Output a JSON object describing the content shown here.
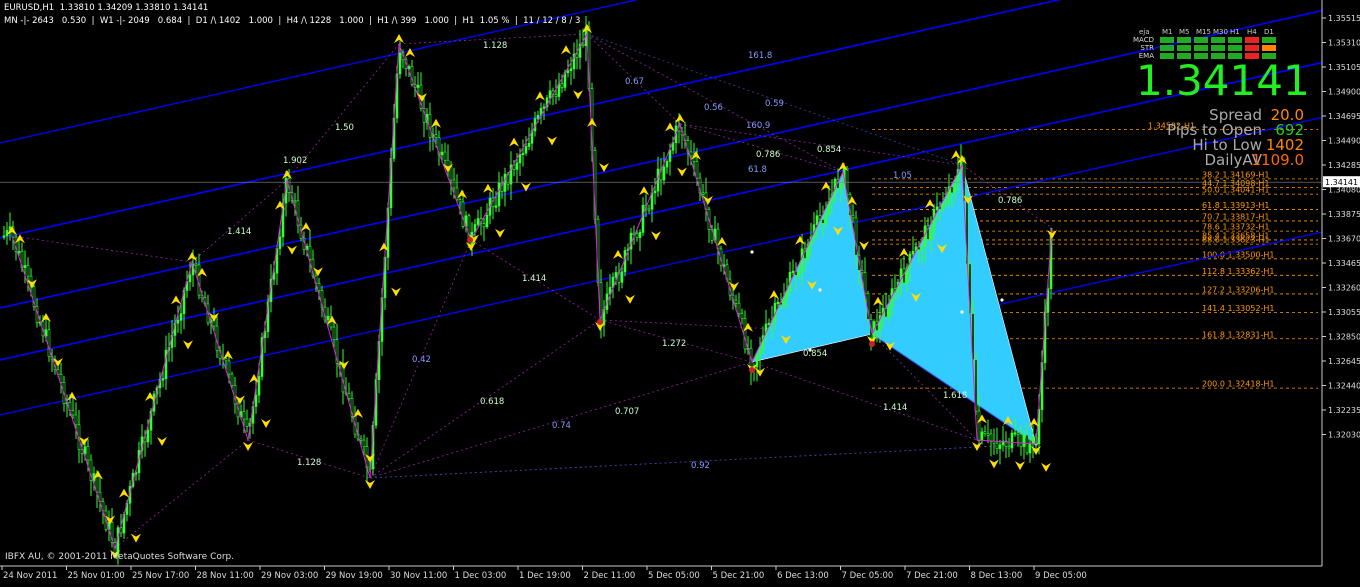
{
  "header": {
    "line1": "EURUSD,H1  1.33810 1.34209 1.33810 1.34141",
    "line2": "MN -|- 2643   0.530  |  W1 -|- 2049   0.684  |  D1 /\\ 1402   1.000  |  H4 /\\ 1228   1.000  |  H1 /\\ 399   1.000  |  H1  1.05 %  |  11 / 12 / 8 / 3"
  },
  "panel": {
    "label_tf": "eja",
    "timeframes": [
      "M1",
      "M5",
      "M15",
      "M30",
      "H1",
      "H4",
      "D1"
    ],
    "rows": [
      {
        "name": "MACD",
        "colors": [
          "#22aa22",
          "#22aa22",
          "#22aa22",
          "#22aa22",
          "#22aa22",
          "#ee2222",
          "#22aa22"
        ]
      },
      {
        "name": "STR",
        "colors": [
          "#22aa22",
          "#22aa22",
          "#22aa22",
          "#22aa22",
          "#22aa22",
          "#ee2222",
          "#ff8800"
        ]
      },
      {
        "name": "EMA",
        "colors": [
          "#22aa22",
          "#22aa22",
          "#22aa22",
          "#22aa22",
          "#22aa22",
          "#ee2222",
          "#22aa22"
        ]
      }
    ],
    "big_price": "1.34141",
    "stats": [
      {
        "label": "Spread",
        "value": "20.0",
        "color": "#ff8800"
      },
      {
        "label": "Pips to Open",
        "value": "692",
        "color": "#22cc22"
      },
      {
        "label": "Hi to Low",
        "value": "1402",
        "color": "#ff8800"
      },
      {
        "label": "DailyAV",
        "value": "1109.0",
        "color": "#ff6600"
      }
    ]
  },
  "copyright": "IBFX AU, © 2001-2011 MetaQuotes Software Corp.",
  "current_price_tag": "1.34141",
  "colors": {
    "candle": "#33ff33",
    "channel": "#0000ff",
    "pattern_fill": "#33ccff",
    "fib_level": "#ff9900",
    "zigzag": "#dd22dd",
    "arrow": "#ffdd00"
  },
  "chart_data": {
    "type": "candlestick",
    "symbol": "EURUSD",
    "timeframe": "H1",
    "ylim": [
      1.32,
      1.3575
    ],
    "y_ticks": [
      "1.35515",
      "1.35310",
      "1.35105",
      "1.34900",
      "1.34695",
      "1.34490",
      "1.34285",
      "1.34080",
      "1.33875",
      "1.33670",
      "1.33465",
      "1.33260",
      "1.33055",
      "1.32850",
      "1.32645",
      "1.32440",
      "1.32235",
      "1.32030"
    ],
    "x_ticks": [
      "24 Nov 2011",
      "25 Nov 01:00",
      "25 Nov 17:00",
      "28 Nov 11:00",
      "29 Nov 03:00",
      "29 Nov 19:00",
      "30 Nov 11:00",
      "1 Dec 03:00",
      "1 Dec 19:00",
      "2 Dec 11:00",
      "5 Dec 05:00",
      "5 Dec 21:00",
      "6 Dec 13:00",
      "7 Dec 05:00",
      "7 Dec 21:00",
      "8 Dec 13:00",
      "9 Dec 05:00"
    ],
    "fib_levels": [
      {
        "label": "38.2  1.34169-H1",
        "value": 1.34169
      },
      {
        "label": "44.7  1.34098-H1",
        "value": 1.34098
      },
      {
        "label": "50.0  1.34041-H1",
        "value": 1.34041
      },
      {
        "label": "61.8  1.33913-H1",
        "value": 1.33913
      },
      {
        "label": "70.7  1.33817-H1",
        "value": 1.33817
      },
      {
        "label": "78.6  1.33732-H1",
        "value": 1.33732
      },
      {
        "label": "85.4  1.33658-H1",
        "value": 1.33658
      },
      {
        "label": "88.6  1.33623-H1",
        "value": 1.33623
      },
      {
        "label": "100.0  1.33500-H1",
        "value": 1.335
      },
      {
        "label": "112.8  1.33362-H1",
        "value": 1.33362
      },
      {
        "label": "127.2  1.33206-H1",
        "value": 1.33206
      },
      {
        "label": "141.4  1.33052-H1",
        "value": 1.33052
      },
      {
        "label": "161.8  1.32831-H1",
        "value": 1.32831
      },
      {
        "label": "200.0  1.32418-H1",
        "value": 1.32418
      }
    ],
    "top_fib_label": "1.34582-H1",
    "ratio_labels": [
      "1.128",
      "0.67",
      "0.56",
      "0.59",
      "1.50",
      "1.902",
      "1.414",
      "161.8",
      "160.9",
      "0.786",
      "0.854",
      "61.8",
      "1.05",
      "0.786",
      "1.414",
      "0.42",
      "0.618",
      "1.272",
      "0.707",
      "0.74",
      "0.92",
      "1.128",
      "0.854",
      "1.414",
      "1.618"
    ]
  }
}
